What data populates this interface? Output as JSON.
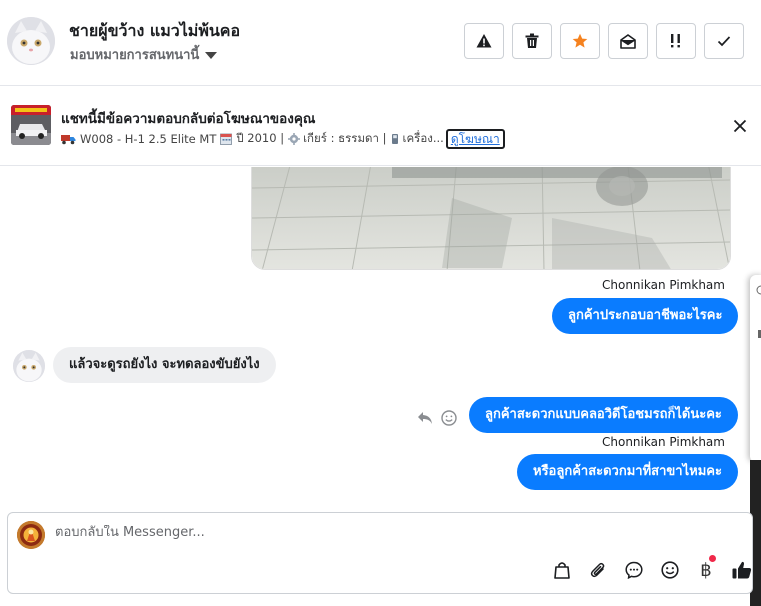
{
  "header": {
    "contact_name": "ชายผู้ขว้าง แมวไม่พ้นคอ",
    "assign_label": "มอบหมายการสนทนานี้",
    "accent_color": "#f5821f"
  },
  "ad": {
    "title": "แชทนี้มีข้อความตอบกลับต่อโฆษณาของคุณ",
    "model": "W008 - H-1 2.5 Elite MT",
    "year": "ปี 2010 |",
    "gear": "เกียร์ : ธรรมดา |",
    "engine": "เครื่อง...",
    "view_ad_link": "ดูโฆษณา"
  },
  "messages": {
    "sender_name_1": "Chonnikan Pimkham",
    "out_1": "ลูกค้าประกอบอาชีพอะไรคะ",
    "in_1": "แล้วจะดูรถยังไง จะทดลองขับยังไง",
    "out_2": "ลูกค้าสะดวกแบบคลอวิดีโอชมรถก็ได้นะคะ",
    "sender_name_2": "Chonnikan Pimkham",
    "out_3": "หรือลูกค้าสะดวกมาที่สาขาไหมคะ"
  },
  "composer": {
    "placeholder": "ตอบกลับใน Messenger...",
    "baht_symbol": "฿"
  }
}
